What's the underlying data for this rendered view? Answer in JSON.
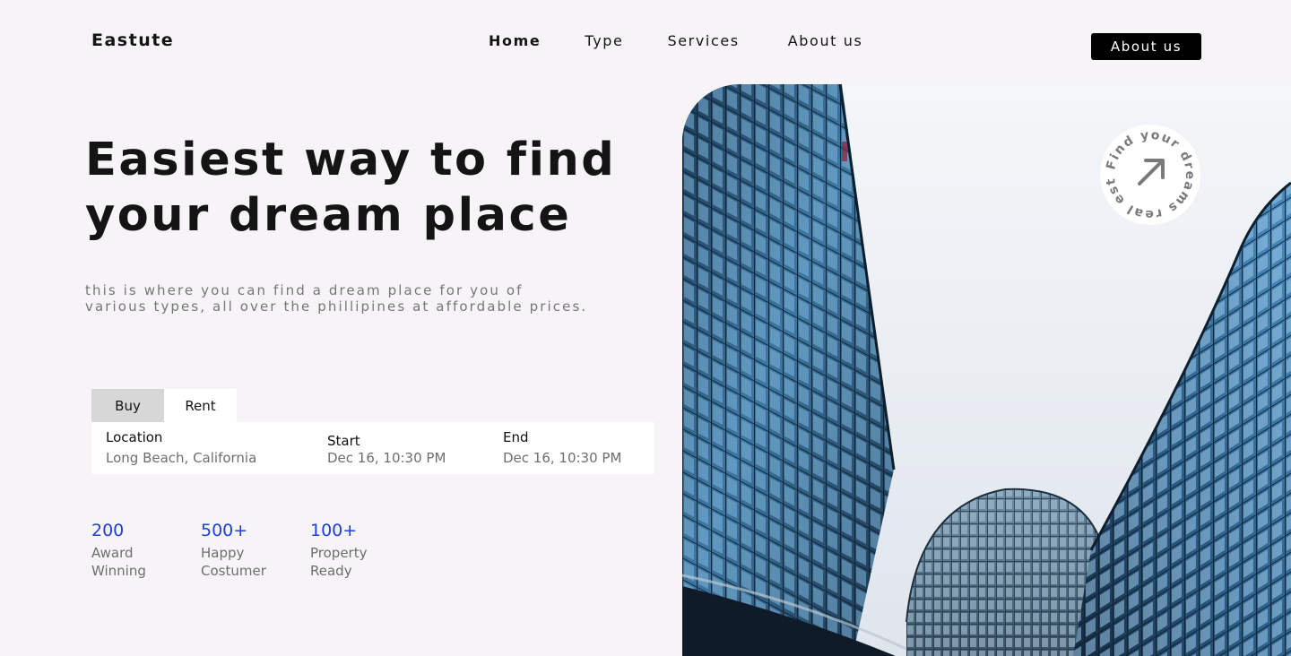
{
  "header": {
    "brand": "Eastute",
    "nav": [
      "Home",
      "Type",
      "Services",
      "About us"
    ],
    "cta_label": "About us"
  },
  "hero": {
    "title_line1": "Easiest way to find",
    "title_line2": "your dream place",
    "subtitle_line1": "this is where you can find a dream place for you of",
    "subtitle_line2": "various types, all over the phillipines at affordable prices.",
    "badge_text": "Find your dreams real estate"
  },
  "search": {
    "tabs": [
      "Buy",
      "Rent"
    ],
    "location_label": "Location",
    "location_value": "Long Beach, California",
    "start_label": "Start",
    "start_value": "Dec 16, 10:30 PM",
    "end_label": "End",
    "end_value": "Dec 16, 10:30 PM"
  },
  "stats": [
    {
      "value": "200",
      "line1": "Award",
      "line2": "Winning"
    },
    {
      "value": "500+",
      "line1": "Happy",
      "line2": "Costumer"
    },
    {
      "value": "100+",
      "line1": "Property",
      "line2": "Ready"
    }
  ],
  "colors": {
    "background": "#f6f4f6",
    "accent_blue": "#1f3fd6",
    "button_bg": "#000000"
  },
  "icons": {
    "badge_arrow": "arrow-up-right-icon"
  }
}
